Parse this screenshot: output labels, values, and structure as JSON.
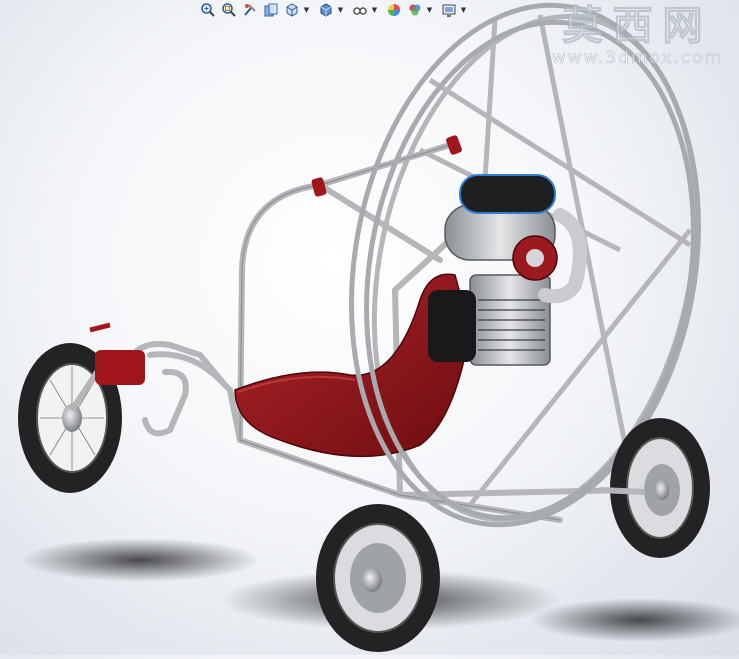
{
  "toolbar": {
    "buttons": [
      {
        "name": "zoom-to-fit-icon"
      },
      {
        "name": "zoom-to-area-icon"
      },
      {
        "name": "previous-view-icon"
      },
      {
        "name": "section-view-icon"
      },
      {
        "name": "view-orientation-icon",
        "dropdown": true
      },
      {
        "name": "display-style-icon",
        "dropdown": true
      },
      {
        "name": "hide-show-items-icon",
        "dropdown": true
      },
      {
        "name": "edit-appearance-icon"
      },
      {
        "name": "apply-scene-icon",
        "dropdown": true
      },
      {
        "name": "view-settings-icon",
        "dropdown": true
      }
    ]
  },
  "watermark": {
    "chinese": "莫西网",
    "url": "www.3dmox.com"
  },
  "colors": {
    "background": "#eef1f5",
    "frame": "#b4b6b9",
    "seat": "#8e1418",
    "engine": "#c7c9cc",
    "tire": "#2a2a2a",
    "accent_blue": "#2f7fd6"
  }
}
